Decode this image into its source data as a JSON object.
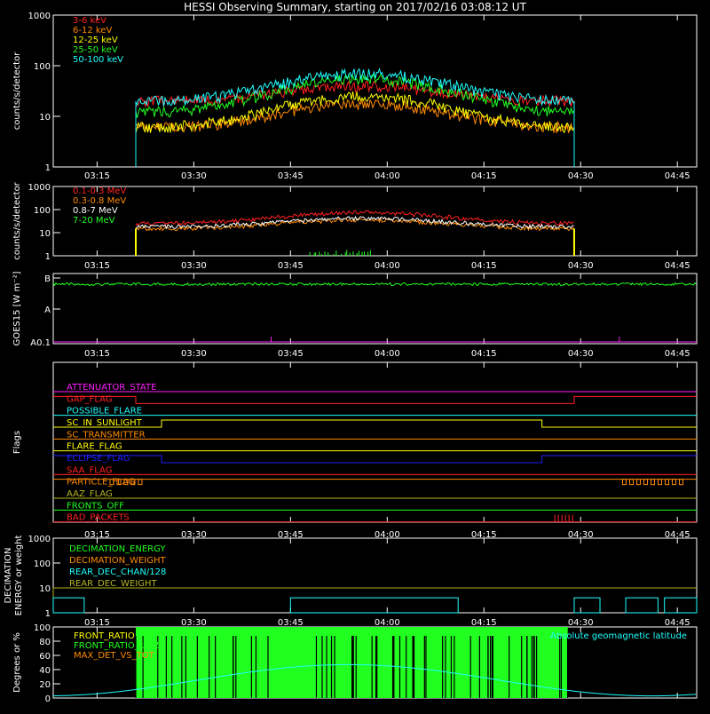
{
  "title": "HESSI Observing Summary, starting on 2017/02/16 03:08:12 UT",
  "time_ticks": [
    "03:15",
    "03:30",
    "03:45",
    "04:00",
    "04:15",
    "04:30",
    "04:45"
  ],
  "colors": {
    "red": "#ff2020",
    "orange": "#ff8a00",
    "yellow": "#ffff00",
    "green": "#20ff20",
    "cyan": "#20ffff",
    "magenta": "#ff20ff",
    "blue": "#2020ff",
    "olive": "#b5b520",
    "white": "#ffffff"
  },
  "chart_data": [
    {
      "panel": "low_energy",
      "type": "line",
      "ylabel": "counts/s/detector",
      "yscale": "log",
      "ylim": [
        1,
        1000
      ],
      "y_ticks": [
        "1",
        "10",
        "100",
        "1000"
      ],
      "xlim": [
        "03:08:12",
        "04:48:00"
      ],
      "data_interval": [
        "03:21",
        "04:29"
      ],
      "series": [
        {
          "name": "3-6 keV",
          "color": "#ff2020",
          "values": [
            20,
            40,
            20
          ]
        },
        {
          "name": "6-12 keV",
          "color": "#ff8a00",
          "values": [
            6,
            18,
            6
          ]
        },
        {
          "name": "12-25 keV",
          "color": "#ffff00",
          "values": [
            6,
            25,
            6
          ]
        },
        {
          "name": "25-50 keV",
          "color": "#20ff20",
          "values": [
            12,
            55,
            12
          ]
        },
        {
          "name": "50-100 keV",
          "color": "#20ffff",
          "values": [
            20,
            70,
            18
          ]
        }
      ]
    },
    {
      "panel": "high_energy",
      "type": "line",
      "ylabel": "counts/s/detector",
      "yscale": "log",
      "ylim": [
        1,
        1000
      ],
      "y_ticks": [
        "1",
        "10",
        "100",
        "1000"
      ],
      "series": [
        {
          "name": "0.1-0.3 MeV",
          "color": "#ff2020",
          "values": [
            25,
            75,
            25
          ]
        },
        {
          "name": "0.3-0.8 MeV",
          "color": "#ff8a00",
          "values": [
            15,
            35,
            15
          ]
        },
        {
          "name": "0.8-7 MeV",
          "color": "#ffffff",
          "values": [
            18,
            42,
            18
          ]
        },
        {
          "name": "7-20 MeV",
          "color": "#20ff20",
          "values": [
            1,
            2,
            1
          ]
        }
      ]
    },
    {
      "panel": "goes",
      "type": "line",
      "ylabel": "GOES15 [W m⁻²]",
      "y_ticks": [
        "A0.1",
        "A",
        "B"
      ],
      "series": [
        {
          "color": "#20ff20",
          "level": "B"
        },
        {
          "color": "#ff20ff",
          "level": "A0.1"
        }
      ]
    },
    {
      "panel": "flags",
      "type": "line",
      "ylabel": "Flags",
      "series": [
        {
          "name": "ATTENUATOR_STATE",
          "color": "#ff20ff"
        },
        {
          "name": "GAP_FLAG",
          "color": "#ff2020"
        },
        {
          "name": "POSSIBLE_FLARE",
          "color": "#20ffff"
        },
        {
          "name": "SC_IN_SUNLIGHT",
          "color": "#ffff00"
        },
        {
          "name": "SC_TRANSMITTER",
          "color": "#ff8a00"
        },
        {
          "name": "FLARE_FLAG",
          "color": "#ffff00"
        },
        {
          "name": "ECLIPSE_FLAG",
          "color": "#2020ff"
        },
        {
          "name": "SAA_FLAG",
          "color": "#ff2020"
        },
        {
          "name": "PARTICLE_FLAG",
          "color": "#ff8a00"
        },
        {
          "name": "AAZ_FLAG",
          "color": "#b5b520"
        },
        {
          "name": "FRONTS_OFF",
          "color": "#20ff20"
        },
        {
          "name": "BAD_PACKETS",
          "color": "#ff2020"
        }
      ]
    },
    {
      "panel": "decimation",
      "type": "line",
      "ylabel": [
        "DECIMATION",
        "ENERGY or weight"
      ],
      "yscale": "log",
      "ylim": [
        1,
        1000
      ],
      "y_ticks": [
        "1",
        "10",
        "100",
        "1000"
      ],
      "series": [
        {
          "name": "DECIMATION_ENERGY",
          "color": "#20ff20"
        },
        {
          "name": "DECIMATION_WEIGHT",
          "color": "#ff8a00"
        },
        {
          "name": "REAR_DEC_CHAN/128",
          "color": "#20ffff"
        },
        {
          "name": "REAR_DEC_WEIGHT",
          "color": "#b5b520"
        }
      ]
    },
    {
      "panel": "ratios",
      "type": "line",
      "ylabel": "Degrees or %",
      "ylim": [
        0,
        100
      ],
      "y_ticks": [
        "0",
        "20",
        "40",
        "60",
        "80",
        "100"
      ],
      "series": [
        {
          "name": "FRONT_RATIO",
          "color": "#ffff00"
        },
        {
          "name": "FRONT_RATIO_1225",
          "color": "#20ff20"
        },
        {
          "name": "MAX_DET_VS_TOT",
          "color": "#ff8a00"
        },
        {
          "name": "Absolute geomagnetic latitude",
          "color": "#20ffff"
        }
      ]
    }
  ]
}
